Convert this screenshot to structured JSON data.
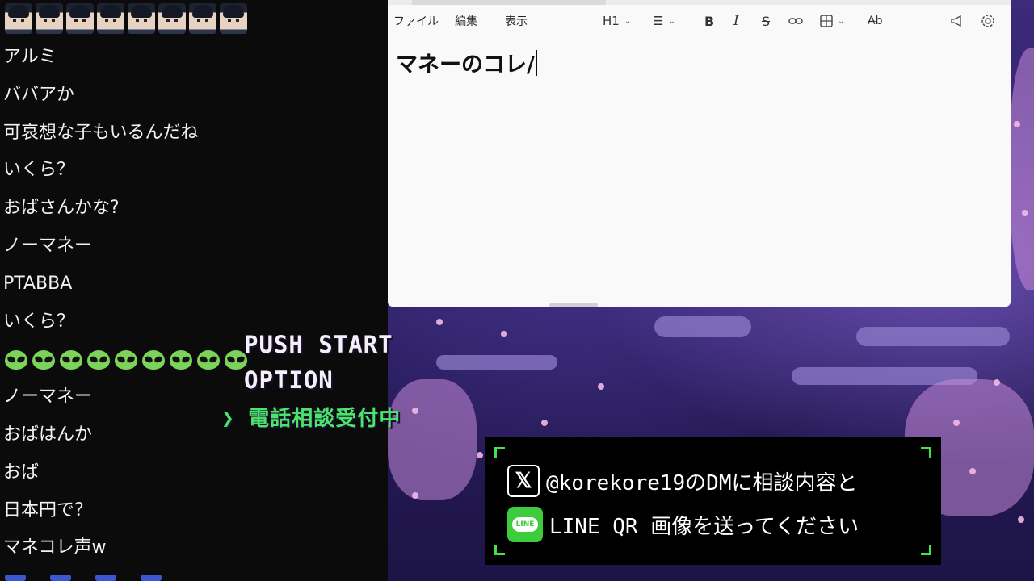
{
  "chat": {
    "emote_count": 8,
    "messages": [
      "アルミ",
      "ババアか",
      "可哀想な子もいるんだね",
      "いくら？",
      "おばさんかな?",
      "ノーマネー",
      "PTABBA",
      "いくら？",
      "",
      "ノーマネー",
      "おばはんか",
      "おば",
      "日本円で？",
      "マネコレ声w"
    ],
    "alien_count": 9
  },
  "notepad": {
    "menu": [
      "ファイル",
      "編集",
      "表示"
    ],
    "toolbar": {
      "heading": "H1",
      "list_icon": "list-icon",
      "bold": "B",
      "italic": "I",
      "strike": "S",
      "link_icon": "link-icon",
      "table_icon": "table-icon",
      "spellcheck_icon": "spellcheck-icon",
      "announce_icon": "megaphone-icon",
      "settings_icon": "gear-icon"
    },
    "editor_text": "マネーのコレ/"
  },
  "game": {
    "menu_start": "PUSH START",
    "menu_option": "OPTION",
    "menu_phone": "❯ 電話相談受付中",
    "info_line1": "@korekore19のDMに相談内容と",
    "info_line2": "LINE QR 画像を送ってください",
    "x_logo": "𝕏",
    "line_logo": "LINE",
    "accent_green": "#3ee34f"
  }
}
